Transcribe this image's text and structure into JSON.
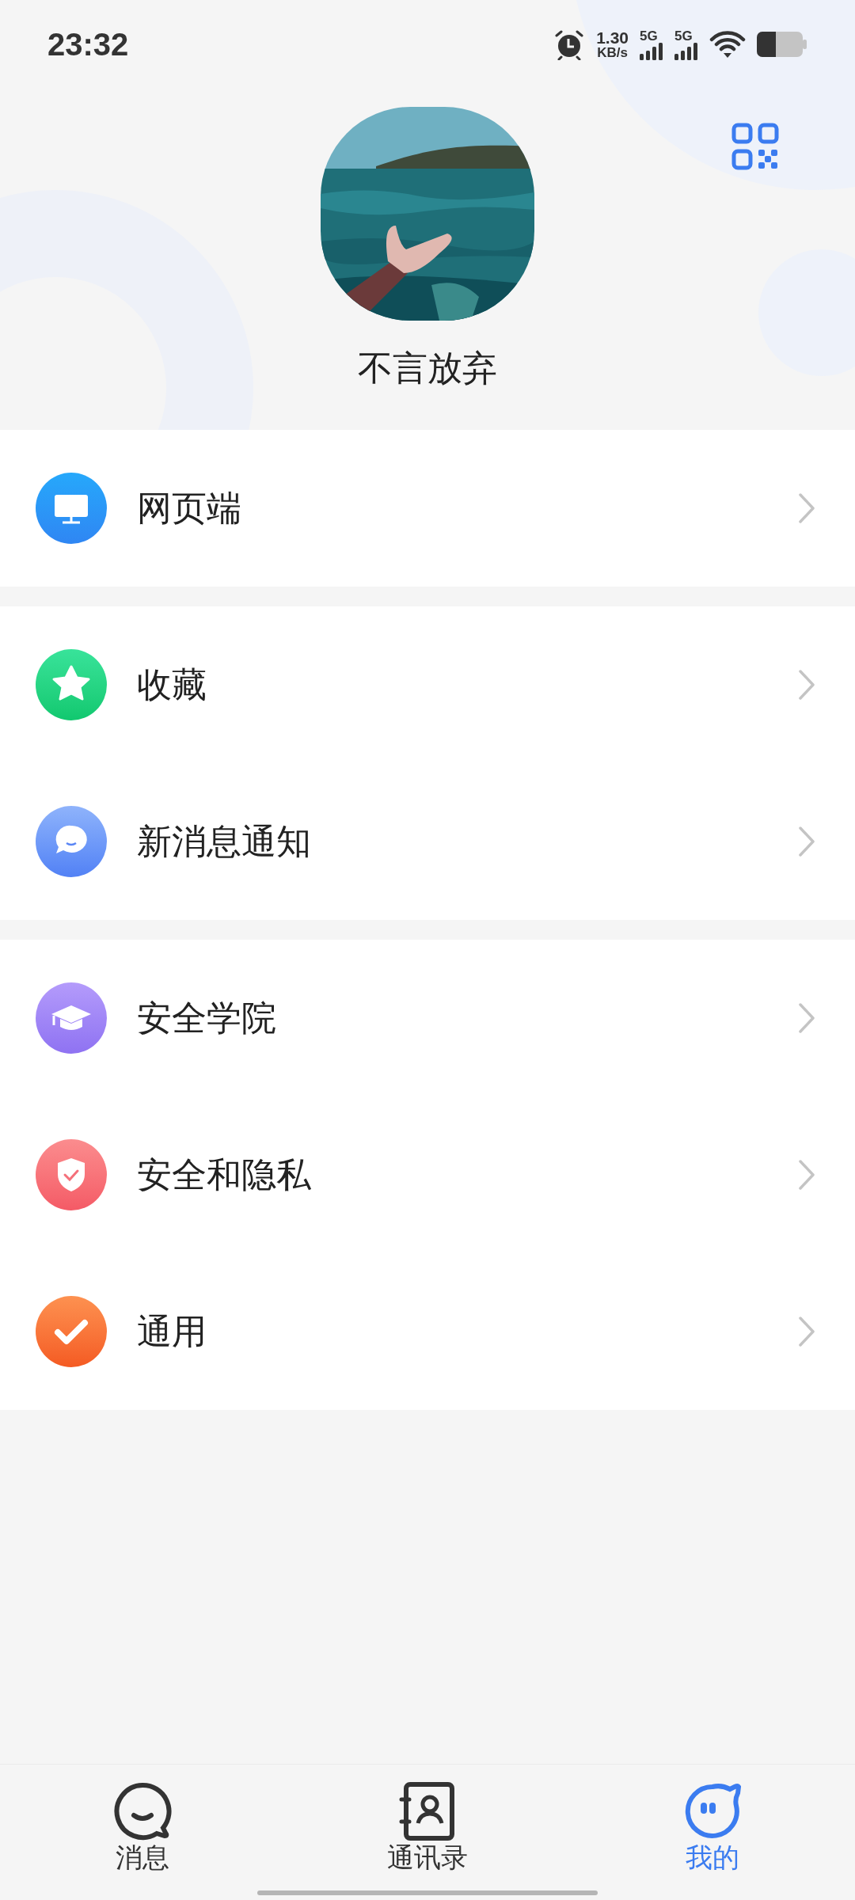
{
  "status_bar": {
    "time": "23:32",
    "net_speed": "1.30",
    "net_unit": "KB/s",
    "sim_1": "5G",
    "sim_2": "5G"
  },
  "profile": {
    "name": "不言放弃"
  },
  "menu_groups": [
    {
      "items": [
        {
          "label": "网页端"
        }
      ]
    },
    {
      "items": [
        {
          "label": "收藏"
        },
        {
          "label": "新消息通知"
        }
      ]
    },
    {
      "items": [
        {
          "label": "安全学院"
        },
        {
          "label": "安全和隐私"
        },
        {
          "label": "通用"
        }
      ]
    }
  ],
  "bottom_nav": [
    {
      "label": "消息",
      "selected": false
    },
    {
      "label": "通讯录",
      "selected": false
    },
    {
      "label": "我的",
      "selected": true
    }
  ]
}
